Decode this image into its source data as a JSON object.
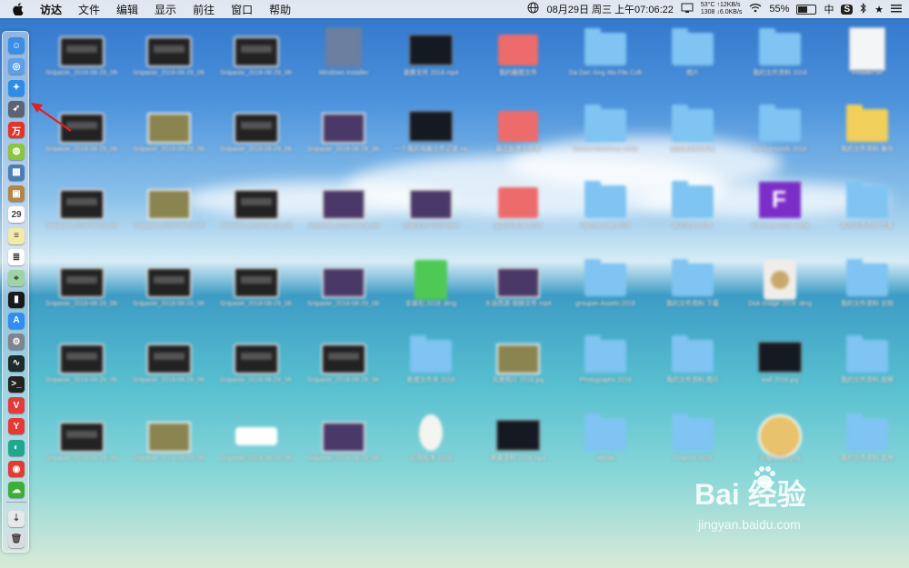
{
  "menubar": {
    "app_name": "访达",
    "menus": [
      "文件",
      "编辑",
      "显示",
      "前往",
      "窗口",
      "帮助"
    ],
    "status": {
      "datetime": "08月29日 周三 上午07:06:22",
      "cpu_temp": "53°C",
      "cpu_usage": "1308",
      "net_up": "↑12KB/s",
      "net_down": "↓6.0KB/s",
      "battery_percent": "55%",
      "battery_level": 0.55,
      "input_method": "中",
      "app_badge": "S"
    },
    "icons": [
      "apple-icon",
      "globe-icon",
      "display-icon",
      "finder-menu-icon",
      "wifi-icon",
      "bluetooth-icon",
      "star-icon",
      "list-icon"
    ]
  },
  "dock": {
    "apps": [
      {
        "name": "finder-icon",
        "color": "#3a8ee6",
        "glyph": "☺"
      },
      {
        "name": "launchpad-icon",
        "color": "#5da0e8",
        "glyph": "◎"
      },
      {
        "name": "safari-icon",
        "color": "#2b8de8",
        "glyph": "✦"
      },
      {
        "name": "rocket-icon",
        "color": "#5b6470",
        "glyph": "➶"
      },
      {
        "name": "red-app-icon",
        "color": "#e2342b",
        "glyph": "万"
      },
      {
        "name": "android-icon",
        "color": "#8cc63e",
        "glyph": "◍"
      },
      {
        "name": "preview-icon",
        "color": "#4e7db5",
        "glyph": "▦"
      },
      {
        "name": "box-icon",
        "color": "#b0864a",
        "glyph": "▣"
      },
      {
        "name": "calendar-icon",
        "color": "#ffffff",
        "glyph": "29"
      },
      {
        "name": "notes-icon",
        "color": "#f3e9a8",
        "glyph": "≡"
      },
      {
        "name": "text-file-icon",
        "color": "#ffffff",
        "glyph": "≣"
      },
      {
        "name": "maps-icon",
        "color": "#9fd3a5",
        "glyph": "⌖"
      },
      {
        "name": "terminal-monitor-icon",
        "color": "#1a1a1a",
        "glyph": "▮"
      },
      {
        "name": "app-store-icon",
        "color": "#2f8ef0",
        "glyph": "A"
      },
      {
        "name": "system-preferences-icon",
        "color": "#7e8590",
        "glyph": "⚙"
      },
      {
        "name": "activity-monitor-icon",
        "color": "#1d2b2b",
        "glyph": "∿"
      },
      {
        "name": "terminal-icon",
        "color": "#222222",
        "glyph": ">_"
      },
      {
        "name": "vivaldi-icon",
        "color": "#e23b3b",
        "glyph": "V"
      },
      {
        "name": "yandex-icon",
        "color": "#e53935",
        "glyph": "Y"
      },
      {
        "name": "teal-app-icon",
        "color": "#1fa78f",
        "glyph": "◐"
      },
      {
        "name": "netease-music-icon",
        "color": "#e03c31",
        "glyph": "◉"
      },
      {
        "name": "wechat-icon",
        "color": "#3db034",
        "glyph": "☁"
      },
      {
        "name": "downloads-icon",
        "color": "#e6e8ec",
        "glyph": "⇣"
      },
      {
        "name": "trash-icon",
        "color": "#d9dde2",
        "glyph": "🗑"
      }
    ]
  },
  "desktop": {
    "icons": [
      [
        {
          "kind": "video",
          "label": "Snipaste_2018-08-29_06-57-11.png"
        },
        {
          "kind": "video",
          "label": "Snipaste_2018-08-29_06-58-23.jpg"
        },
        {
          "kind": "video",
          "label": "Snipaste_2018-08-29_06-59-01.jpg"
        },
        {
          "kind": "app",
          "label": "Windows Installer"
        },
        {
          "kind": "dark",
          "label": "录屏文件 2018 mp4"
        },
        {
          "kind": "red",
          "label": "我的截图文件"
        },
        {
          "kind": "folder",
          "label": "Da Dan Xing Wa File Collection"
        },
        {
          "kind": "folder",
          "label": "图片"
        },
        {
          "kind": "folder",
          "label": "我的文件资料 2018"
        },
        {
          "kind": "doc",
          "label": "Installer.txt"
        }
      ],
      [
        {
          "kind": "video",
          "label": "Snipaste_2018-08-29_06-56-52.jpg"
        },
        {
          "kind": "photo",
          "label": "Snipaste_2018-08-29_06-56-28.jpg"
        },
        {
          "kind": "video",
          "label": "Snipaste_2018-08-29_06-55-19.jpg"
        },
        {
          "kind": "purple",
          "label": "Snipaste_2018-08-29_06-53-43.jpg"
        },
        {
          "kind": "dark",
          "label": "一个我的电脑文件记录 mp4"
        },
        {
          "kind": "red",
          "label": "最近新建文件夹"
        },
        {
          "kind": "folder",
          "label": "Winnie Machines 2018"
        },
        {
          "kind": "folder",
          "label": "我的素材文件夹"
        },
        {
          "kind": "folder",
          "label": "Backgrounds 2018"
        },
        {
          "kind": "yfolder",
          "label": "我的文件资料 备份"
        }
      ],
      [
        {
          "kind": "video",
          "label": "Snipaste_2018-08-29_06-51-50.jpg"
        },
        {
          "kind": "photo",
          "label": "Snipaste_2018-08-29_06-50-46.jpg"
        },
        {
          "kind": "video",
          "label": "Snipaste_2018-08-29_06-49-57.jpg"
        },
        {
          "kind": "purple",
          "label": "Snipaste_2018-08-29_06-48-30.jpg"
        },
        {
          "kind": "purple",
          "label": "视频文件 2018 mp4"
        },
        {
          "kind": "red",
          "label": "我的文件夹 2018"
        },
        {
          "kind": "folder",
          "label": "Da Dan File 2018"
        },
        {
          "kind": "folder",
          "label": "我的资料 文件"
        },
        {
          "kind": "ffile",
          "label": "Fotoview 2018 .dmg"
        },
        {
          "kind": "folder",
          "label": "我的文件资料 合集"
        }
      ],
      [
        {
          "kind": "video",
          "label": "Snipaste_2018-08-29_06-47-12.jpg"
        },
        {
          "kind": "video",
          "label": "Snipaste_2018-08-29_06-46-01.jpg"
        },
        {
          "kind": "video",
          "label": "Snipaste_2018-08-29_06-45-33.jpg"
        },
        {
          "kind": "purple",
          "label": "Snipaste_2018-08-29_06-44-20.jpg"
        },
        {
          "kind": "green",
          "label": "安装包 2018 .dmg"
        },
        {
          "kind": "purple",
          "label": "大话西游 视频文件 mp4"
        },
        {
          "kind": "folder",
          "label": "groupon Assets 2018"
        },
        {
          "kind": "folder",
          "label": "我的文件资料 下载"
        },
        {
          "kind": "disc",
          "label": "Disk Image 2018 .dmg"
        },
        {
          "kind": "folder",
          "label": "我的文件资料 文档"
        }
      ],
      [
        {
          "kind": "video",
          "label": "Snipaste_2018-08-29_06-43-05.jpg"
        },
        {
          "kind": "video",
          "label": "Snipaste_2018-08-29_06-42-11.jpg"
        },
        {
          "kind": "video",
          "label": "Snipaste_2018-08-29_06-41-40.jpg"
        },
        {
          "kind": "video",
          "label": "Snipaste_2018-08-29_06-40-18.jpg"
        },
        {
          "kind": "folder",
          "label": "新建文件夹 2018"
        },
        {
          "kind": "photo",
          "label": "风景照片 2018 jpg"
        },
        {
          "kind": "folder",
          "label": "Photographs 2018"
        },
        {
          "kind": "folder",
          "label": "我的文件资料 图片"
        },
        {
          "kind": "dark",
          "label": "wall 2018.jpg"
        },
        {
          "kind": "folder",
          "label": "我的文件资料 视频"
        }
      ],
      [
        {
          "kind": "video",
          "label": "Snipaste_2018-08-29_06-39-02.jpg"
        },
        {
          "kind": "photo",
          "label": "Snipaste_2018-08-29_06-38-14.jpg"
        },
        {
          "kind": "pill",
          "label": "Snipaste_2018-08-29_06-37-20.jpg"
        },
        {
          "kind": "purple",
          "label": "Snipaste_2018-08-29_06-36-45.jpg"
        },
        {
          "kind": "egg",
          "label": "应用程序 2018"
        },
        {
          "kind": "dark",
          "label": "屏幕录制 2018 mp4"
        },
        {
          "kind": "folder",
          "label": "Media"
        },
        {
          "kind": "folder",
          "label": "Projects 2018"
        },
        {
          "kind": "round",
          "label": "头像 2018.png"
        },
        {
          "kind": "folder",
          "label": "我的文件资料 其他"
        }
      ]
    ]
  },
  "watermark": {
    "brand": "Bai  经验",
    "url": "jingyan.baidu.com"
  },
  "annotation": {
    "arrow_color": "#e02020"
  }
}
